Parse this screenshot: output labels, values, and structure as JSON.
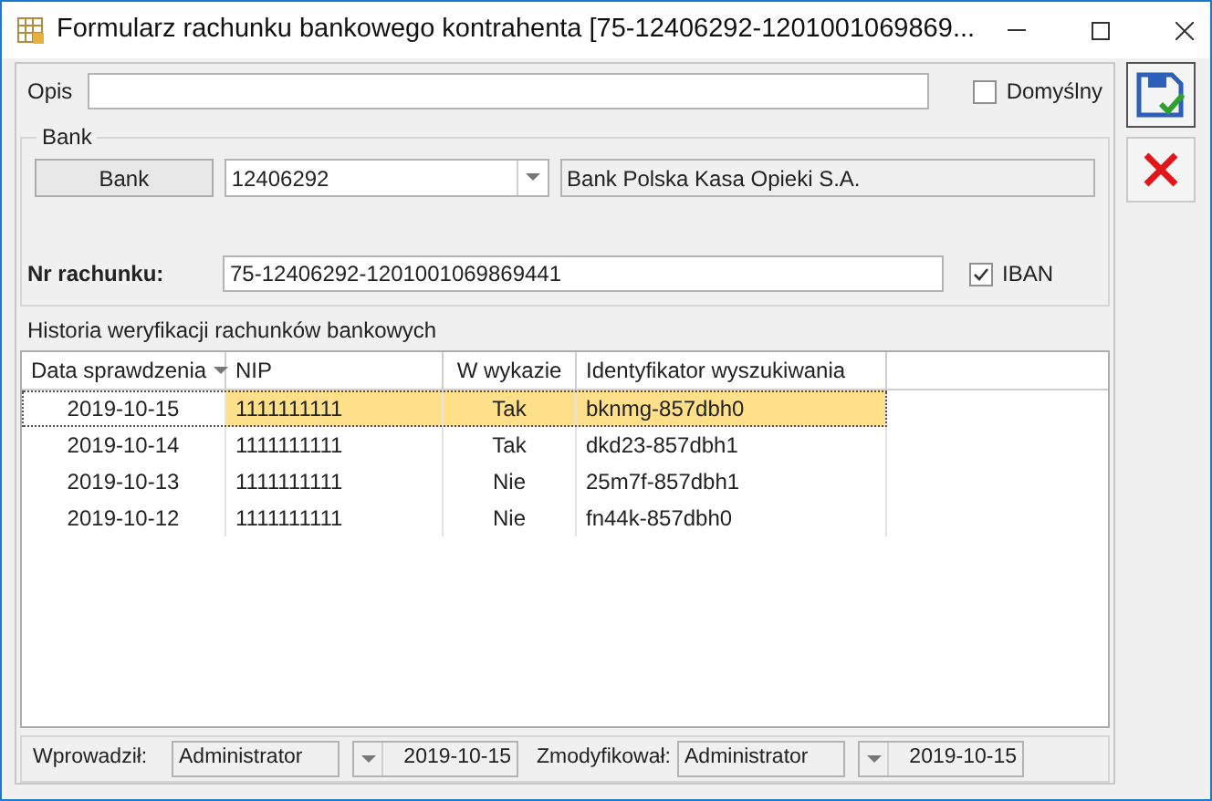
{
  "window": {
    "title": "Formularz rachunku bankowego kontrahenta [75-12406292-1201001069869..."
  },
  "opis": {
    "label": "Opis"
  },
  "default_checkbox": {
    "label": "Domyślny",
    "checked": false
  },
  "bank_group": {
    "legend": "Bank",
    "button": "Bank",
    "code": "12406292",
    "name": "Bank Polska Kasa Opieki S.A."
  },
  "account": {
    "label": "Nr rachunku:",
    "value": "75-12406292-1201001069869441",
    "iban": {
      "label": "IBAN",
      "checked": true
    }
  },
  "history": {
    "title": "Historia weryfikacji rachunków bankowych",
    "columns": [
      {
        "label": "Data sprawdzenia",
        "sorted": true
      },
      {
        "label": "NIP",
        "sorted": false
      },
      {
        "label": "W wykazie",
        "sorted": false
      },
      {
        "label": "Identyfikator wyszukiwania",
        "sorted": false
      }
    ],
    "rows": [
      {
        "selected": true,
        "cells": [
          "2019-10-15",
          "1111111111",
          "Tak",
          "bknmg-857dbh0"
        ]
      },
      {
        "selected": false,
        "cells": [
          "2019-10-14",
          "1111111111",
          "Tak",
          "dkd23-857dbh1"
        ]
      },
      {
        "selected": false,
        "cells": [
          "2019-10-13",
          "1111111111",
          "Nie",
          "25m7f-857dbh1"
        ]
      },
      {
        "selected": false,
        "cells": [
          "2019-10-12",
          "1111111111",
          "Nie",
          "fn44k-857dbh0"
        ]
      }
    ]
  },
  "footer": {
    "entered_label": "Wprowadził:",
    "entered_by": "Administrator",
    "entered_date": "2019-10-15",
    "modified_label": "Zmodyfikował:",
    "modified_by": "Administrator",
    "modified_date": "2019-10-15"
  }
}
